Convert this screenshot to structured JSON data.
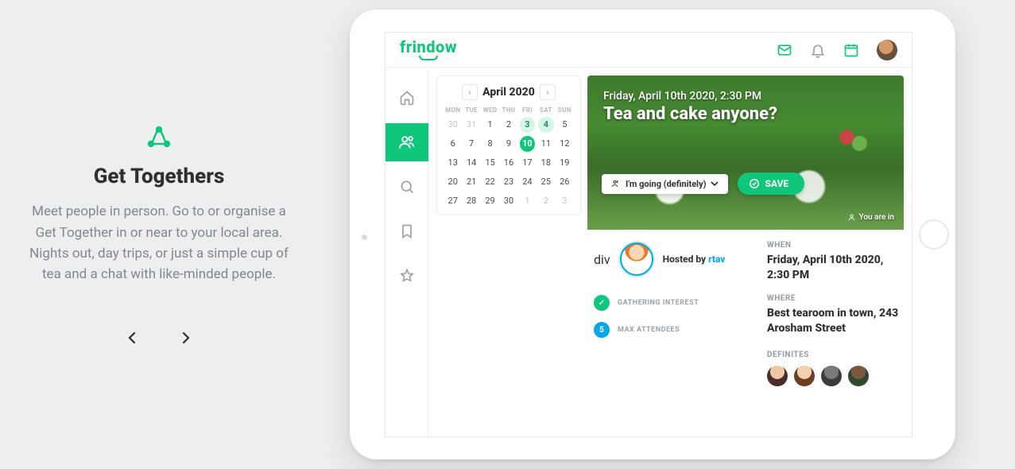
{
  "promo": {
    "title": "Get Togethers",
    "description": "Meet people in person. Go to or organise a Get Together in or near to your local area. Nights out, day trips, or just a simple cup of tea and a chat with like-minded people."
  },
  "app": {
    "brand": "frindow"
  },
  "calendar": {
    "month_label": "April 2020",
    "dow": [
      "MON",
      "TUE",
      "WED",
      "THU",
      "FRI",
      "SAT",
      "SUN"
    ],
    "weeks": [
      [
        {
          "d": "30",
          "muted": true
        },
        {
          "d": "31",
          "muted": true
        },
        {
          "d": "1"
        },
        {
          "d": "2"
        },
        {
          "d": "3",
          "light": true
        },
        {
          "d": "4",
          "light": true
        },
        {
          "d": "5"
        }
      ],
      [
        {
          "d": "6"
        },
        {
          "d": "7"
        },
        {
          "d": "8"
        },
        {
          "d": "9"
        },
        {
          "d": "10",
          "sel": true
        },
        {
          "d": "11"
        },
        {
          "d": "12"
        }
      ],
      [
        {
          "d": "13"
        },
        {
          "d": "14"
        },
        {
          "d": "15"
        },
        {
          "d": "16"
        },
        {
          "d": "17"
        },
        {
          "d": "18"
        },
        {
          "d": "19"
        }
      ],
      [
        {
          "d": "20"
        },
        {
          "d": "21"
        },
        {
          "d": "22"
        },
        {
          "d": "23"
        },
        {
          "d": "24"
        },
        {
          "d": "25"
        },
        {
          "d": "26"
        }
      ],
      [
        {
          "d": "27"
        },
        {
          "d": "28"
        },
        {
          "d": "29"
        },
        {
          "d": "30"
        },
        {
          "d": "1",
          "muted": true
        },
        {
          "d": "2",
          "muted": true
        },
        {
          "d": "3",
          "muted": true
        }
      ]
    ]
  },
  "event": {
    "date_line": "Friday, April 10th 2020, 2:30 PM",
    "title": "Tea and cake anyone?",
    "going_label": "I'm going (definitely)",
    "save_label": "SAVE",
    "badge": "You are in",
    "host_prefix": "Hosted by ",
    "host_name": "rtav",
    "gathering_label": "GATHERING INTEREST",
    "max_attendees_value": "5",
    "max_attendees_label": "MAX ATTENDEES",
    "when_label": "WHEN",
    "when_value": "Friday, April 10th 2020, 2:30 PM",
    "where_label": "WHERE",
    "where_value": "Best tearoom in town, 243 Arosham Street",
    "definites_label": "DEFINITES"
  }
}
